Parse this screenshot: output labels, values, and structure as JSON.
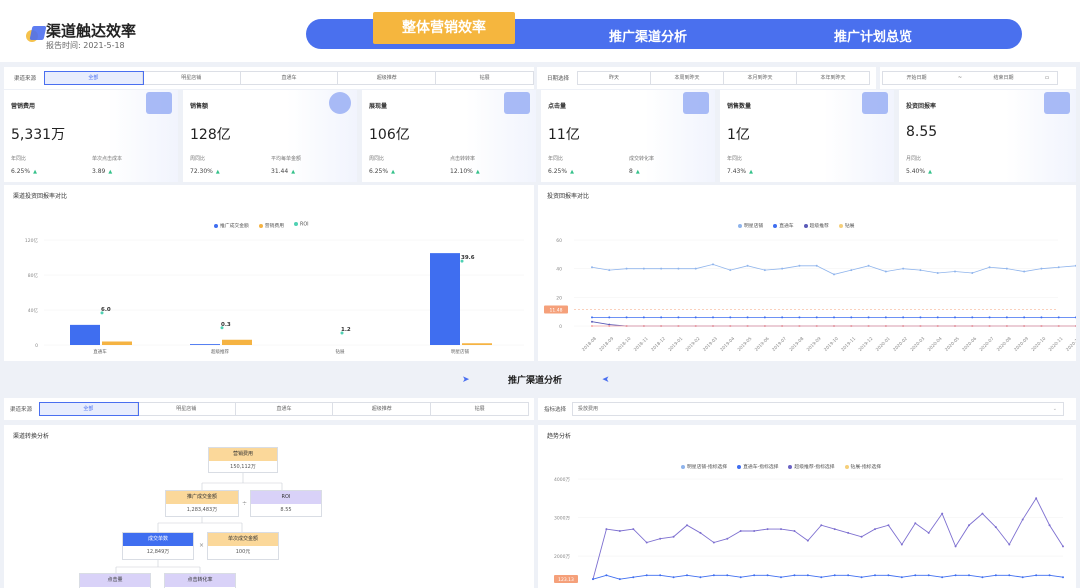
{
  "header": {
    "title": "渠道触达效率",
    "report_time": "报告时间:  2021-5-18",
    "nav": {
      "active": "整体营销效率",
      "tab2": "推广渠道分析",
      "tab3": "推广计划总览"
    }
  },
  "filter1": {
    "label": "渠道来源",
    "options": [
      "全部",
      "明星店铺",
      "直通车",
      "超级推荐",
      "钻展"
    ],
    "date_label": "日期选择",
    "dates": [
      "昨天",
      "本周到昨天",
      "本月到昨天",
      "本年到昨天"
    ],
    "start_placeholder": "开始日期",
    "sep": "~",
    "end_placeholder": "结束日期"
  },
  "kpis": [
    {
      "title": "营销费用",
      "value": "5,331万",
      "l1": "年同比",
      "v1": "6.25%",
      "l2": "单次点击成本",
      "v2": "3.89"
    },
    {
      "title": "销售额",
      "value": "128亿",
      "l1": "周同比",
      "v1": "72.30%",
      "l2": "平均每单金额",
      "v2": "31.44"
    },
    {
      "title": "展现量",
      "value": "106亿",
      "l1": "周同比",
      "v1": "6.25%",
      "l2": "点击转转率",
      "v2": "12.10%"
    },
    {
      "title": "点击量",
      "value": "11亿",
      "l1": "年同比",
      "v1": "6.25%",
      "l2": "成交转化率",
      "v2": "8"
    },
    {
      "title": "销售数量",
      "value": "1亿",
      "l1": "年同比",
      "v1": "7.43%",
      "l2": "",
      "v2": ""
    },
    {
      "title": "投资回报率",
      "value": "8.55",
      "l1": "月同比",
      "v1": "5.40%",
      "l2": "",
      "v2": ""
    }
  ],
  "chart1": {
    "title": "渠道投资回报率对比",
    "legend": [
      "推广成交金额",
      "营销费用",
      "ROI"
    ]
  },
  "chart2": {
    "title": "投资回报率对比",
    "legend": [
      "明星店铺",
      "直通车",
      "超级推荐",
      "钻展"
    ],
    "marker": "11.48"
  },
  "section": {
    "title": "推广渠道分析"
  },
  "filter2": {
    "label": "渠道来源",
    "options": [
      "全部",
      "明星店铺",
      "直通车",
      "超级推荐",
      "钻展"
    ],
    "metric_label": "指标选择",
    "metric_value": "投放费用"
  },
  "funnel": {
    "title": "渠道转换分析",
    "n1": {
      "h": "营销费用",
      "v": "150,112万"
    },
    "n2": {
      "h": "推广成交金额",
      "v": "1,283,483万"
    },
    "op1": "÷",
    "n3": {
      "h": "ROI",
      "v": "8.55"
    },
    "n4": {
      "h": "成交单数",
      "v": "12,849万"
    },
    "op2": "×",
    "n5": {
      "h": "单次成交金额",
      "v": "100元"
    },
    "n6": {
      "h": "点击量"
    },
    "n7": {
      "h": "点击转化率"
    }
  },
  "chart3": {
    "title": "趋势分析",
    "legend": [
      "明星店铺-指标选择",
      "直通车-指标选择",
      "超级推荐-指标选择",
      "钻展-指标选择"
    ],
    "marker": "123.13"
  },
  "chart_data": [
    {
      "type": "bar",
      "title": "渠道投资回报率对比",
      "categories": [
        "直通车",
        "超级推荐",
        "钻展",
        "明星店铺"
      ],
      "series": [
        {
          "name": "推广成交金额",
          "values": [
            23,
            1,
            0,
            105
          ]
        },
        {
          "name": "营销费用",
          "values": [
            4,
            6,
            0,
            2
          ]
        },
        {
          "name": "ROI",
          "values": [
            6.0,
            0.3,
            1.2,
            39.6
          ]
        }
      ],
      "yticks": [
        "0",
        "40亿",
        "80亿",
        "120亿"
      ],
      "ylim": [
        0,
        120
      ]
    },
    {
      "type": "line",
      "title": "投资回报率对比",
      "x": [
        "2018-08",
        "2018-09",
        "2018-10",
        "2018-11",
        "2018-12",
        "2019-01",
        "2019-02",
        "2019-03",
        "2019-04",
        "2019-05",
        "2019-06",
        "2019-07",
        "2019-08",
        "2019-09",
        "2019-10",
        "2019-11",
        "2019-12",
        "2020-01",
        "2020-02",
        "2020-03",
        "2020-04",
        "2020-05",
        "2020-06",
        "2020-07",
        "2020-08",
        "2020-09",
        "2020-10",
        "2020-11",
        "2020-12"
      ],
      "yticks": [
        "0",
        "20",
        "40",
        "60"
      ],
      "ylim": [
        0,
        60
      ],
      "series": [
        {
          "name": "明星店铺",
          "values": [
            41,
            39,
            40,
            40,
            40,
            40,
            40,
            43,
            39,
            42,
            39,
            40,
            42,
            42,
            36,
            39,
            42,
            38,
            40,
            39,
            37,
            38,
            37,
            41,
            40,
            38,
            40,
            41,
            42
          ]
        },
        {
          "name": "直通车",
          "values": [
            6,
            6,
            6,
            6,
            6,
            6,
            6,
            6,
            6,
            6,
            6,
            6,
            6,
            6,
            6,
            6,
            6,
            6,
            6,
            6,
            6,
            6,
            6,
            6,
            6,
            6,
            6,
            6,
            6
          ]
        },
        {
          "name": "超级推荐",
          "values": [
            3,
            1,
            0,
            0,
            0,
            0,
            0,
            0,
            0,
            0,
            0,
            0,
            0,
            0,
            0,
            0,
            0,
            0,
            0,
            0,
            0,
            0,
            0,
            0,
            0,
            0,
            0,
            0,
            0
          ]
        },
        {
          "name": "钻展",
          "values": [
            0,
            0,
            0,
            0,
            0,
            0,
            0,
            0,
            0,
            0,
            0,
            0,
            0,
            0,
            0,
            0,
            0,
            0,
            0,
            0,
            0,
            0,
            0,
            0,
            0,
            0,
            0,
            0,
            0
          ]
        }
      ]
    },
    {
      "type": "line",
      "title": "趋势分析",
      "yticks": [
        "2000万",
        "3000万",
        "4000万"
      ],
      "ylim": [
        1300,
        4000
      ],
      "series": [
        {
          "name": "超级推荐-指标选择",
          "values": [
            1400,
            2700,
            2650,
            2700,
            2350,
            2450,
            2500,
            2800,
            2600,
            2350,
            2450,
            2650,
            2650,
            2700,
            2700,
            2650,
            2400,
            2800,
            2700,
            2600,
            2500,
            2700,
            2800,
            2300,
            2850,
            2600,
            3100,
            2250,
            2800,
            3100,
            2750,
            2300,
            2950,
            3500,
            2800,
            2250
          ]
        },
        {
          "name": "直通车-指标选择",
          "values": [
            1400,
            1500,
            1400,
            1450,
            1500,
            1500,
            1450,
            1500,
            1450,
            1500,
            1500,
            1450,
            1500,
            1500,
            1450,
            1500,
            1500,
            1450,
            1500,
            1500,
            1450,
            1500,
            1500,
            1450,
            1500,
            1500,
            1450,
            1500,
            1500,
            1450,
            1500,
            1500,
            1450,
            1500,
            1500,
            1450
          ]
        }
      ]
    }
  ]
}
